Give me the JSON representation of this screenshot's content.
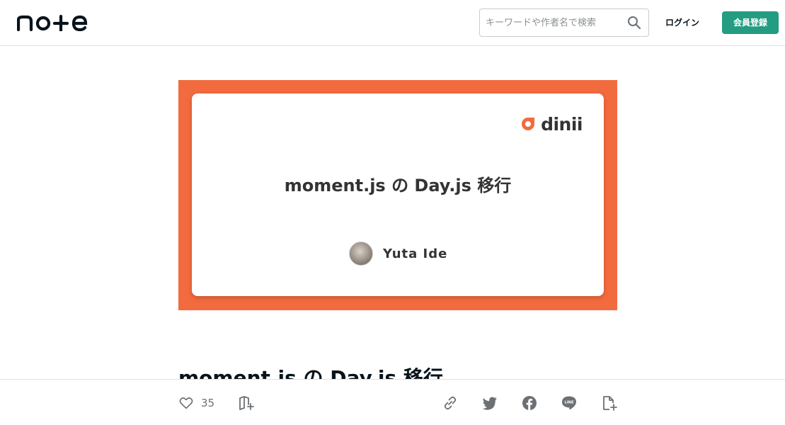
{
  "header": {
    "logo_text": "note",
    "search": {
      "placeholder": "キーワードや作者名で検索",
      "value": ""
    },
    "login_label": "ログイン",
    "signup_label": "会員登録"
  },
  "eyecatch": {
    "brand_name": "dinii",
    "title": "moment.js の Day.js 移行",
    "author_name": "Yuta Ide",
    "colors": {
      "background": "#f26b3f",
      "brand_accent": "#f26b3f"
    }
  },
  "article": {
    "title": "moment.js の Day.js 移行"
  },
  "action_bar": {
    "like_count": "35",
    "icons": [
      "heart-icon",
      "magazine-add-icon",
      "link-icon",
      "twitter-icon",
      "facebook-icon",
      "line-icon",
      "note-add-icon"
    ]
  },
  "colors": {
    "accent": "#249c81",
    "text": "#08131a"
  }
}
